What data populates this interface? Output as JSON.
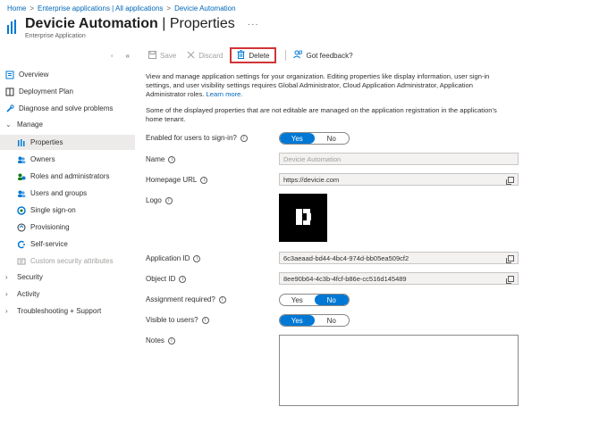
{
  "breadcrumb": {
    "home": "Home",
    "enterprise_apps": "Enterprise applications | All applications",
    "app": "Devicie Automation"
  },
  "header": {
    "app_name": "Devicie Automation",
    "section": "Properties",
    "separator": "|",
    "subtitle": "Enterprise Application",
    "more": "···"
  },
  "sidebar": {
    "collapse_glyph": "«",
    "search_glyph": "◦",
    "items": [
      {
        "label": "Overview"
      },
      {
        "label": "Deployment Plan"
      },
      {
        "label": "Diagnose and solve problems"
      },
      {
        "label": "Manage"
      },
      {
        "label": "Properties"
      },
      {
        "label": "Owners"
      },
      {
        "label": "Roles and administrators"
      },
      {
        "label": "Users and groups"
      },
      {
        "label": "Single sign-on"
      },
      {
        "label": "Provisioning"
      },
      {
        "label": "Self-service"
      },
      {
        "label": "Custom security attributes"
      },
      {
        "label": "Security"
      },
      {
        "label": "Activity"
      },
      {
        "label": "Troubleshooting + Support"
      }
    ]
  },
  "toolbar": {
    "save": "Save",
    "discard": "Discard",
    "delete": "Delete",
    "feedback": "Got feedback?"
  },
  "main": {
    "description": "View and manage application settings for your organization. Editing properties like display information, user sign-in settings, and user visibility settings requires Global Administrator, Cloud Application Administrator, Application Administrator roles.",
    "learn_more": "Learn more.",
    "note": "Some of the displayed properties that are not editable are managed on the application registration in the application's home tenant.",
    "fields": {
      "enabled_label": "Enabled for users to sign-in?",
      "name_label": "Name",
      "name_value": "Devicie Automation",
      "homepage_label": "Homepage URL",
      "homepage_value": "https://devicie.com",
      "logo_label": "Logo",
      "app_id_label": "Application ID",
      "app_id_value": "6c3aeaad-bd44-4bc4-974d-bb05ea509cf2",
      "object_id_label": "Object ID",
      "object_id_value": "8ee90b64-4c3b-4fcf-b86e-cc516d145489",
      "assignment_label": "Assignment required?",
      "visible_label": "Visible to users?",
      "notes_label": "Notes"
    },
    "toggle": {
      "yes": "Yes",
      "no": "No"
    },
    "toggle_states": {
      "enabled": "Yes",
      "assignment": "No",
      "visible": "Yes"
    },
    "info_glyph": "i"
  },
  "colors": {
    "accent": "#0078d4",
    "link": "#0067b8",
    "delete_highlight": "#d13438"
  }
}
